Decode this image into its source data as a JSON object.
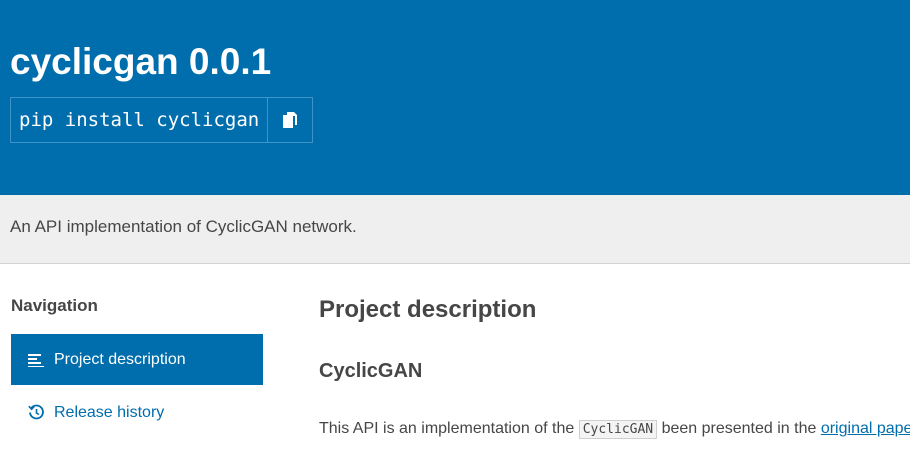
{
  "header": {
    "package_title": "cyclicgan 0.0.1",
    "pip_command": "pip install cyclicgan",
    "copy_icon": "copy-icon",
    "background_color": "#006dad"
  },
  "summary": {
    "text": "An API implementation of CyclicGAN network."
  },
  "navigation": {
    "heading": "Navigation",
    "items": [
      {
        "label": "Project description",
        "icon": "lines-icon",
        "active": true
      },
      {
        "label": "Release history",
        "icon": "history-icon",
        "active": false
      }
    ]
  },
  "content": {
    "title": "Project description",
    "section_title": "CyclicGAN",
    "paragraph": {
      "prefix": "This API is an implementation of the ",
      "code": "CyclicGAN",
      "middle": " been presented in the ",
      "link": "original paper",
      "suffix": "."
    }
  },
  "colors": {
    "accent": "#006dad",
    "text": "#464646",
    "summary_bg": "#efefef"
  }
}
